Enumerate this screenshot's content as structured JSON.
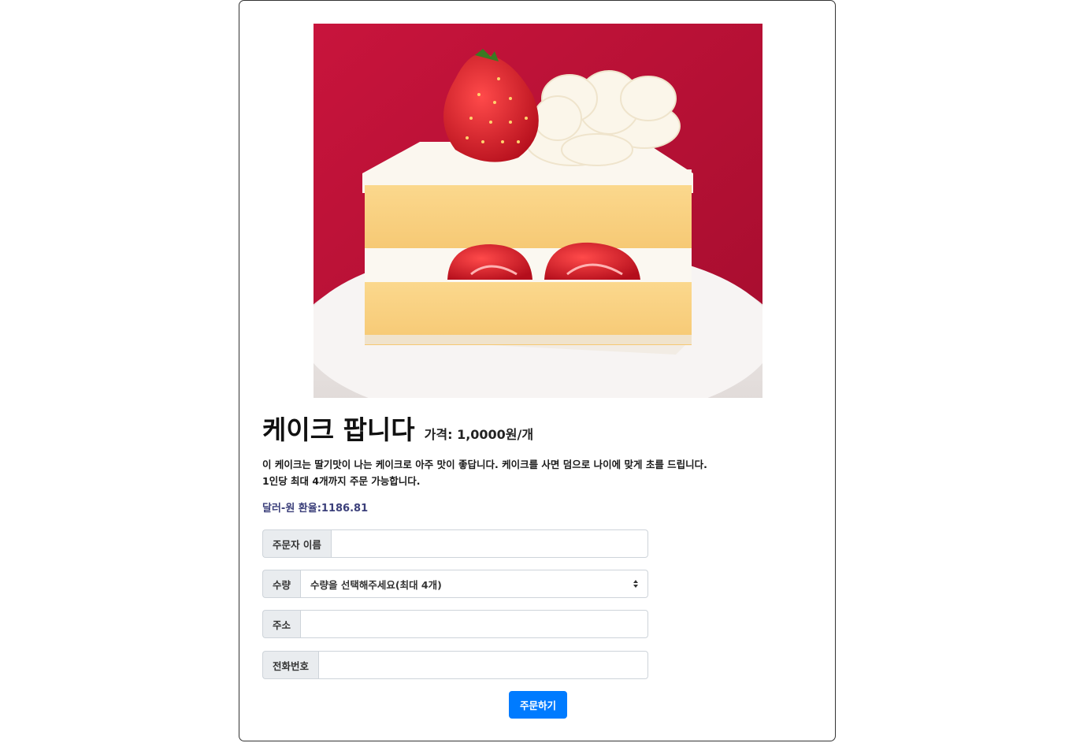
{
  "product": {
    "title": "케이크 팝니다",
    "price": "가격: 1,0000원/개",
    "description_line1": "이 케이크는 딸기맛이 나는 케이크로 아주 맛이 좋답니다. 케이크를 사면 덤으로 나이에 맞게 초를 드립니다.",
    "description_line2": "1인당 최대 4개까지 주문 가능합니다.",
    "exchange_rate": "달러-원 환율:1186.81",
    "image_alt": "strawberry shortcake slice"
  },
  "form": {
    "name_label": "주문자 이름",
    "name_value": "",
    "quantity_label": "수량",
    "quantity_selected": "수량을 선택해주세요(최대 4개)",
    "address_label": "주소",
    "address_value": "",
    "phone_label": "전화번호",
    "phone_value": "",
    "submit_label": "주문하기"
  },
  "colors": {
    "primary_button": "#007bff",
    "addon_bg": "#e9ecef",
    "rate_text": "#3b3f7a"
  },
  "icons": {
    "select_caret": "sort-caret-icon"
  }
}
